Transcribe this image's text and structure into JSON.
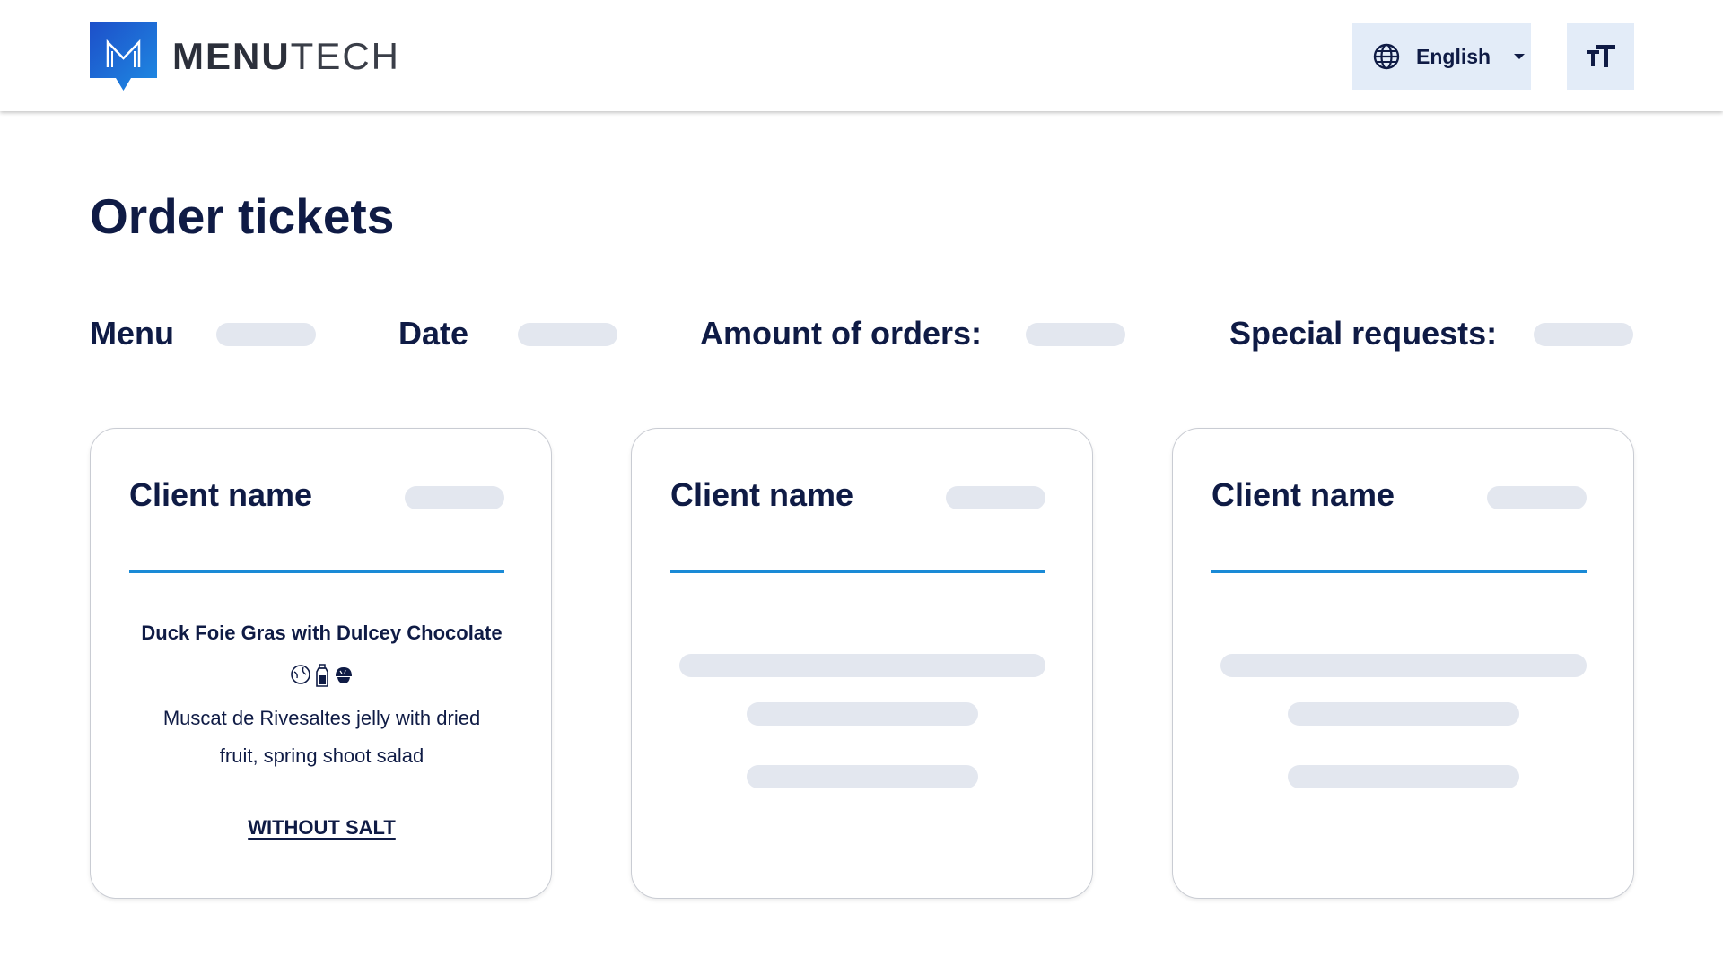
{
  "header": {
    "logo_bold": "MENU",
    "logo_light": "TECH",
    "language_label": "English",
    "icons": {
      "language": "globe-icon",
      "dropdown": "caret-down-icon",
      "text_size": "text-size-icon"
    }
  },
  "page": {
    "title": "Order tickets",
    "filters": {
      "menu_label": "Menu",
      "date_label": "Date",
      "amount_label": "Amount of orders:",
      "special_label": "Special requests:"
    }
  },
  "cards": [
    {
      "client_label": "Client name",
      "dish_title": "Duck Foie Gras with Dulcey Chocolate",
      "allergen_icons": [
        "egg-icon",
        "milk-bottle-icon",
        "nut-icon"
      ],
      "dish_description": "Muscat de Rivesaltes jelly with dried fruit, spring shoot salad",
      "special_request": "WITHOUT SALT"
    },
    {
      "client_label": "Client name"
    },
    {
      "client_label": "Client name"
    }
  ],
  "colors": {
    "primary_text": "#0f1b45",
    "accent_blue": "#1a8ad6",
    "logo_blue": "#1f6fd8",
    "button_bg": "#e3ecf8",
    "skeleton": "#e3e7ef"
  }
}
